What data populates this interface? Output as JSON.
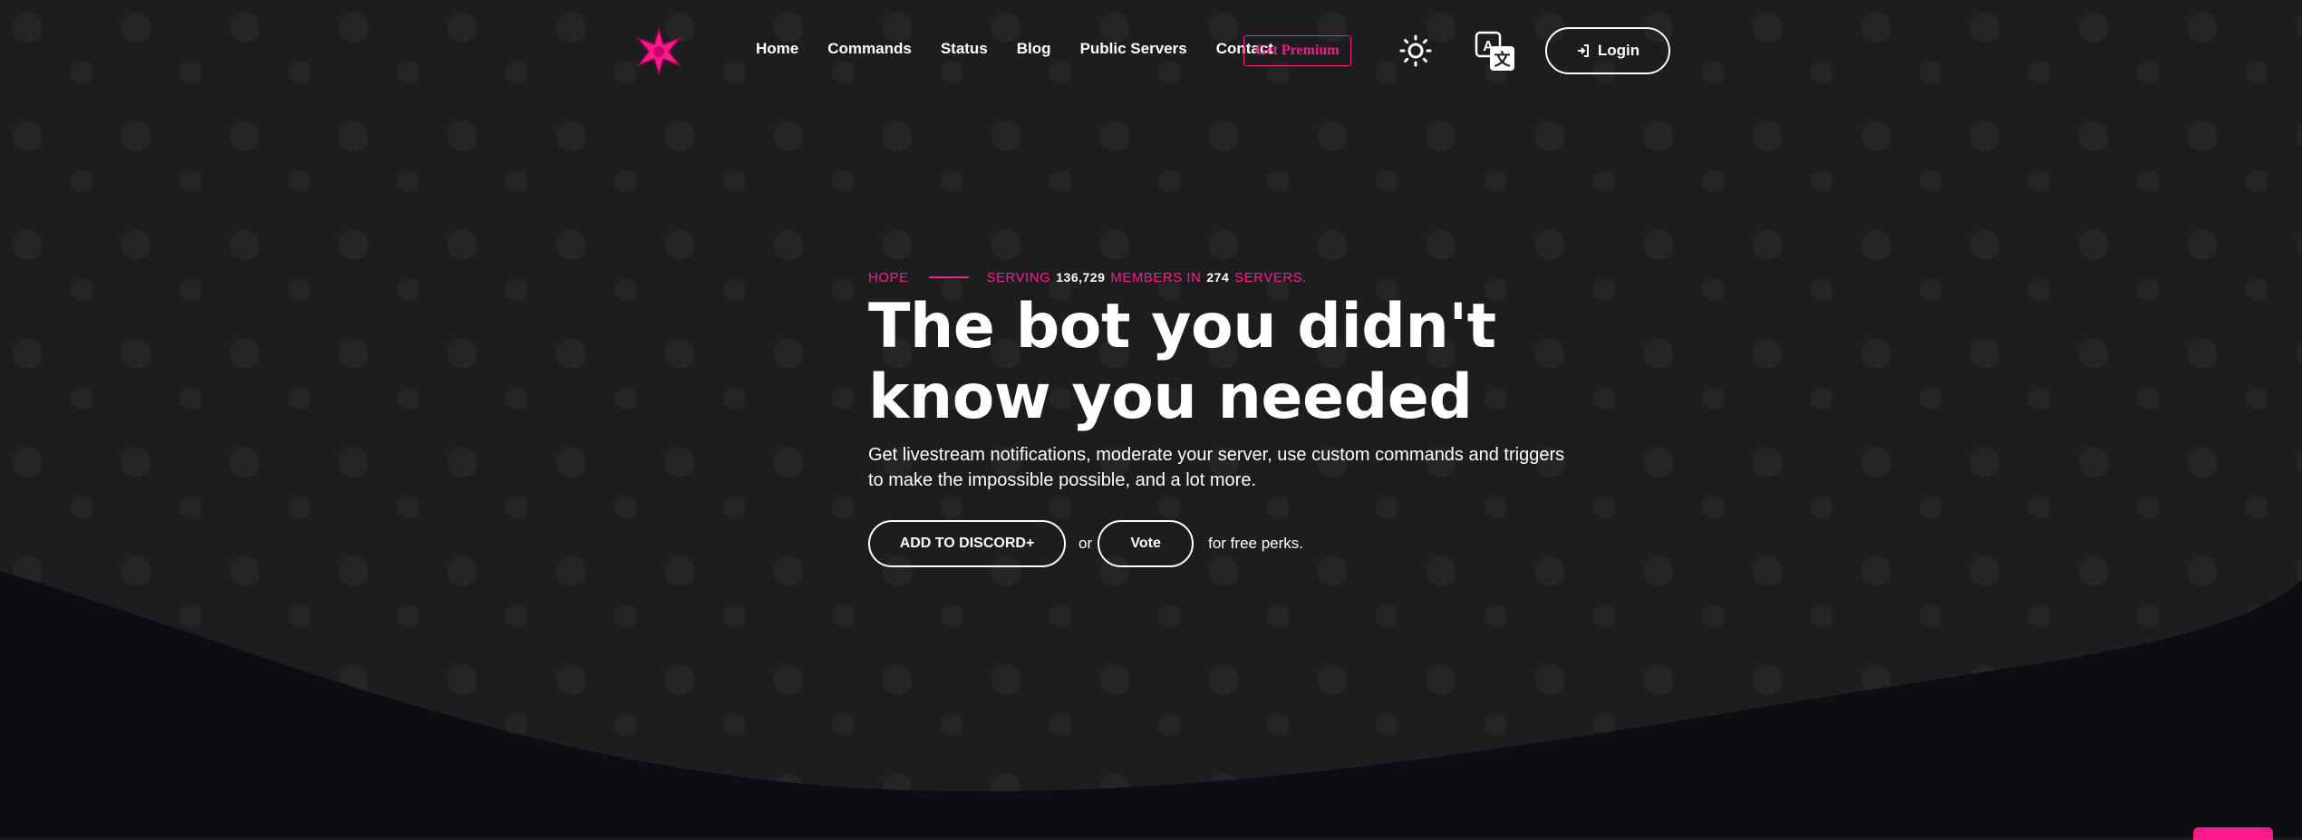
{
  "brand": {
    "accent": "#ff1a8c",
    "logo_icon": "pink-star-logo-icon"
  },
  "nav": {
    "links": [
      "Home",
      "Commands",
      "Status",
      "Blog",
      "Public Servers",
      "Contact"
    ],
    "premium_label": "Get Premium",
    "theme_icon": "sun-icon",
    "language_icon": "translate-icon",
    "login_label": "Login",
    "login_icon": "sign-in-icon"
  },
  "hero": {
    "bot_name": "HOPE",
    "serving_label": "SERVING",
    "members_count": "136,729",
    "members_label": "MEMBERS IN",
    "servers_count": "274",
    "servers_label": "SERVERS.",
    "headline_line1": "The bot you didn't",
    "headline_line2": "know you needed",
    "description": "Get livestream notifications, moderate your server, use custom commands and triggers to make the impossible possible, and a lot more.",
    "add_button": "ADD TO DISCORD+",
    "or_text": "or",
    "vote_button": "Vote",
    "perks_text": "for free perks."
  },
  "colors": {
    "background": "#1d1d20",
    "wave": "#0e0e12",
    "text": "#ffffff"
  }
}
